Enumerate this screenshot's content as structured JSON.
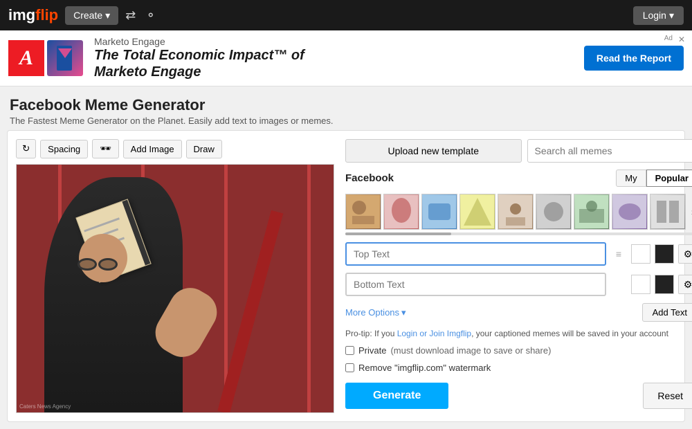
{
  "nav": {
    "logo_img": "img",
    "logo_text_1": "img",
    "logo_text_2": "flip",
    "create_label": "Create",
    "login_label": "Login"
  },
  "ad": {
    "label": "Ad",
    "close": "✕",
    "brand": "Marketo Engage",
    "headline": "The Total Economic Impact™ of",
    "headline2": "Marketo Engage",
    "cta": "Read the Report"
  },
  "page": {
    "title": "Facebook Meme Generator",
    "subtitle": "The Fastest Meme Generator on the Planet. Easily add text to images or memes."
  },
  "toolbar": {
    "refresh_title": "↺",
    "spacing_label": "Spacing",
    "glasses_label": "🕶",
    "add_image_label": "Add Image",
    "draw_label": "Draw"
  },
  "right": {
    "upload_label": "Upload new template",
    "search_placeholder": "Search all memes",
    "tab_label": "Facebook",
    "my_label": "My",
    "popular_label": "Popular"
  },
  "text_fields": {
    "top_placeholder": "Top Text",
    "bottom_placeholder": "Bottom Text"
  },
  "options": {
    "more_options": "More Options",
    "add_text": "Add Text",
    "pro_tip": "Pro-tip: If you ",
    "login_link": "Login or Join Imgflip",
    "pro_tip_end": ", your captioned memes will be saved in your account"
  },
  "checkboxes": {
    "private_label": "Private",
    "private_note": "(must download image to save or share)",
    "watermark_label": "Remove \"imgflip.com\" watermark"
  },
  "actions": {
    "generate_label": "Generate",
    "reset_label": "Reset"
  },
  "thumbnails": [
    {
      "bg": "#d4a870",
      "icon": ""
    },
    {
      "bg": "#c06060",
      "icon": ""
    },
    {
      "bg": "#4080c0",
      "icon": ""
    },
    {
      "bg": "#c0c060",
      "icon": ""
    },
    {
      "bg": "#a08060",
      "icon": ""
    },
    {
      "bg": "#808080",
      "icon": ""
    },
    {
      "bg": "#608060",
      "icon": ""
    },
    {
      "bg": "#8060a0",
      "icon": ""
    },
    {
      "bg": "#909090",
      "icon": ""
    }
  ]
}
